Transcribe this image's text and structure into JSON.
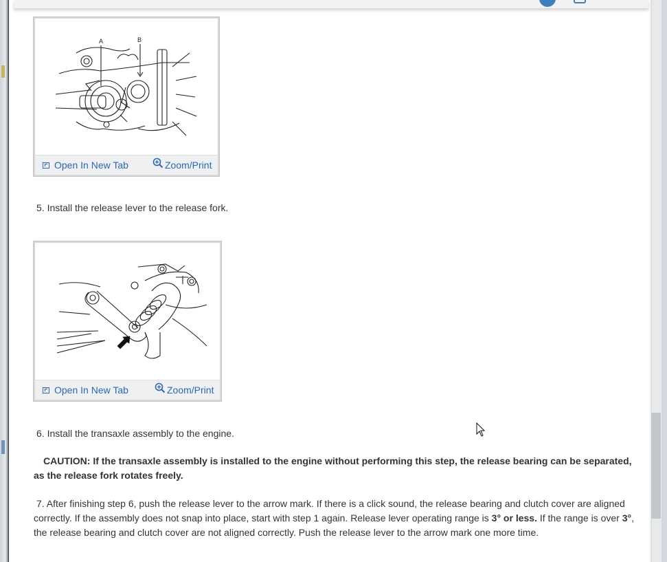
{
  "figures": [
    {
      "open_label": "Open In New Tab",
      "zoom_label": "Zoom/Print",
      "callout_a": "A",
      "callout_b": "B"
    },
    {
      "open_label": "Open In New Tab",
      "zoom_label": "Zoom/Print"
    }
  ],
  "steps": {
    "step5": "5. Install the release lever to the release fork.",
    "step6": "6. Install the transaxle assembly to the engine.",
    "caution": "CAUTION: If the transaxle assembly is installed to the engine without performing this step, the release bearing can be separated, as the release fork rotates freely.",
    "step7_a": "7. After finishing step 6, push the release lever to the arrow mark. If there is a click sound, the release bearing and clutch cover are aligned correctly. If the assembly does not snap into place, start with step 1 again. Release lever operating range is ",
    "step7_b": "3° or less.",
    "step7_c": " If the range is over ",
    "step7_d": "3°",
    "step7_e": ", the release bearing and clutch cover are not aligned correctly. Push the release lever to the arrow mark one more time."
  },
  "colors": {
    "link": "#2e67b1",
    "text": "#333333",
    "background": "#ffffff"
  },
  "icons": [
    "open-in-new-tab-icon",
    "zoom-icon",
    "mouse-cursor-icon"
  ]
}
